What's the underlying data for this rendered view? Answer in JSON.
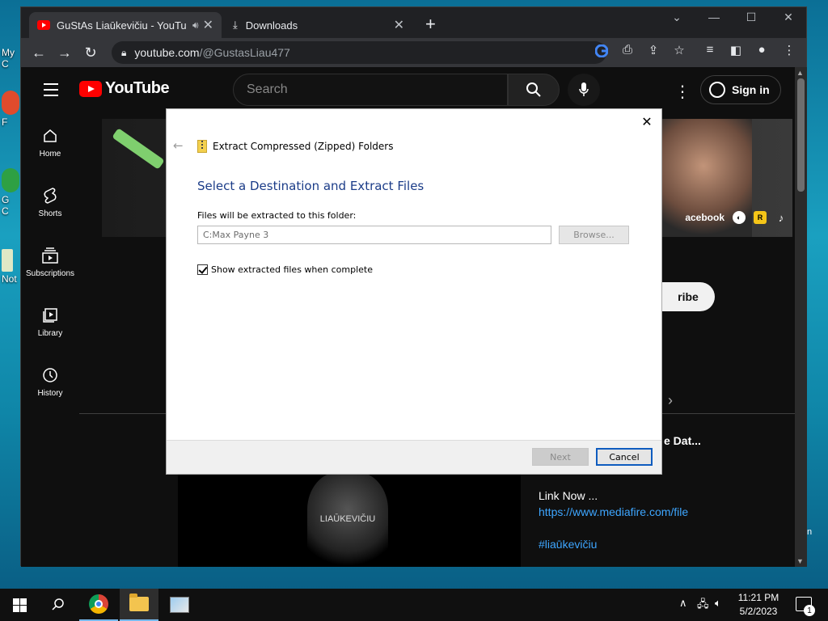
{
  "desktop": {
    "icons": [
      {
        "label": "My C"
      },
      {
        "label": "F"
      },
      {
        "label": "G"
      },
      {
        "label": "C"
      },
      {
        "label": "Not"
      }
    ],
    "edge_text": "n"
  },
  "browser": {
    "tabs": [
      {
        "title": "GuStAs Liaūkevičiu - YouTube",
        "close": "✕"
      },
      {
        "title": "Downloads",
        "close": "✕"
      }
    ],
    "new_tab": "+",
    "window_controls": {
      "tab_search": "⌄",
      "minimize": "—",
      "maximize": "☐",
      "close": "✕"
    },
    "address": {
      "host": "youtube.com",
      "path": "/@GustasLiau477"
    }
  },
  "youtube": {
    "logo_text": "YouTube",
    "search_placeholder": "Search",
    "sign_in": "Sign in",
    "sidebar": [
      {
        "label": "Home",
        "icon": "home-icon"
      },
      {
        "label": "Shorts",
        "icon": "shorts-icon"
      },
      {
        "label": "Subscriptions",
        "icon": "subscriptions-icon"
      },
      {
        "label": "Library",
        "icon": "library-icon"
      },
      {
        "label": "History",
        "icon": "history-icon"
      }
    ],
    "banner_link": "acebook",
    "subscribe_partial": "ribe",
    "video_title_partial": "e Dat...",
    "description": {
      "line1": "Link Now ...",
      "link": "https://www.mediafire.com/file",
      "tag": "#liaūkevičiu"
    },
    "emblem_text": "LIAŪKEVIČIU"
  },
  "dialog": {
    "header": "Extract Compressed (Zipped) Folders",
    "title": "Select a Destination and Extract Files",
    "folder_label": "Files will be extracted to this folder:",
    "folder_value": "C:Max Payne 3",
    "browse": "Browse...",
    "show_files_label": "Show extracted files when complete",
    "show_files_checked": true,
    "next": "Next",
    "cancel": "Cancel"
  },
  "taskbar": {
    "time": "11:21 PM",
    "date": "5/2/2023",
    "notification_count": "1"
  }
}
